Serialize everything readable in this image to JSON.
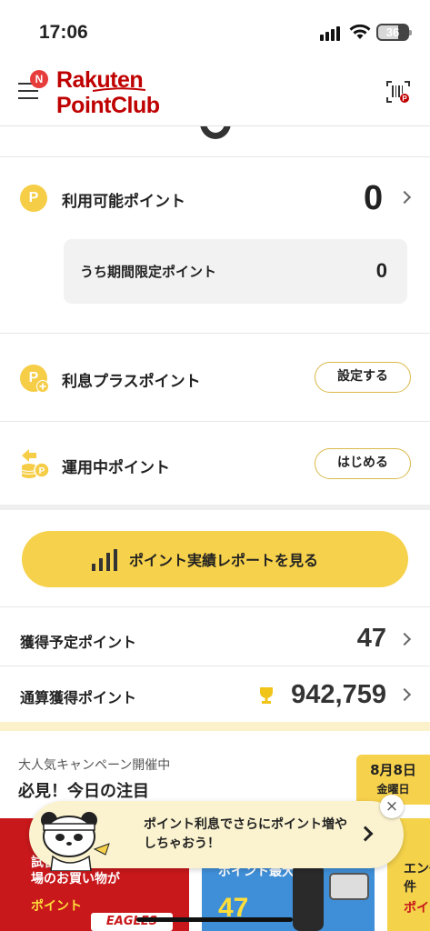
{
  "status_bar": {
    "time": "17:06",
    "battery": "36"
  },
  "header": {
    "notification_badge": "N",
    "logo_line1": "Rakuten",
    "logo_line2": "PointClub",
    "brand_color": "#bf0000"
  },
  "available_points": {
    "label": "利用可能ポイント",
    "value": "0",
    "coin_glyph": "P",
    "limited_label": "うち期間限定ポイント",
    "limited_value": "0"
  },
  "interest_plus": {
    "label": "利息プラスポイント",
    "button_label": "設定する",
    "coin_glyph": "P"
  },
  "investing": {
    "label": "運用中ポイント",
    "button_label": "はじめる"
  },
  "report_button": {
    "label": "ポイント実績レポートを見る"
  },
  "pending_points": {
    "label": "獲得予定ポイント",
    "value": "47"
  },
  "total_points": {
    "label": "通算獲得ポイント",
    "value": "942,759"
  },
  "campaign": {
    "subtitle": "大人気キャンペーン開催中",
    "title": "必見！今日の注目",
    "date": "8月8日",
    "weekday": "金曜日"
  },
  "banners": [
    {
      "line1": "試合に勝った翌日は楽天市場のお買い物が",
      "line2": "ポイント",
      "badge": "EAGLES"
    },
    {
      "line1": "ポイント最大",
      "line2": "47"
    },
    {
      "line1": "エン条件",
      "line2": "ポイ"
    }
  ],
  "toast": {
    "text": "ポイント利息でさらにポイント増やしちゃおう！",
    "close_glyph": "×"
  },
  "colors": {
    "accent_yellow": "#f6d14b",
    "coin_yellow": "#f5cd46",
    "pill_border": "#d9b94a"
  }
}
